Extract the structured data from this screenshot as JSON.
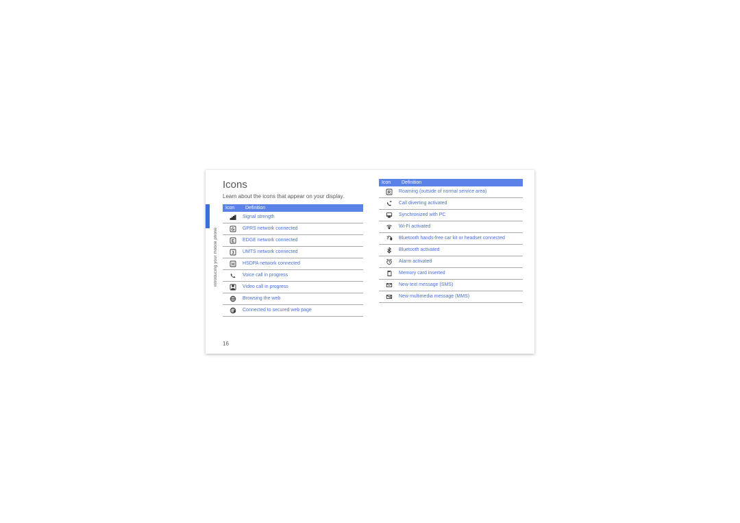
{
  "section": {
    "title": "Icons",
    "intro": "Learn about the icons that appear on your display.",
    "side_label": "introducing your mobile phone",
    "page_number": "16",
    "header": {
      "icon": "Icon",
      "definition": "Definition"
    }
  },
  "left_rows": [
    {
      "icon": "signal",
      "definition": "Signal strength"
    },
    {
      "icon": "gprs",
      "definition": "GPRS network connected"
    },
    {
      "icon": "edge",
      "definition": "EDGE network connected"
    },
    {
      "icon": "umts",
      "definition": "UMTS network connected"
    },
    {
      "icon": "hsdpa",
      "definition": "HSDPA network connected"
    },
    {
      "icon": "voice",
      "definition": "Voice call in progress"
    },
    {
      "icon": "video",
      "definition": "Video call in progress"
    },
    {
      "icon": "web",
      "definition": "Browsing the web"
    },
    {
      "icon": "secure",
      "definition": "Connected to secured web page"
    }
  ],
  "right_rows": [
    {
      "icon": "roaming",
      "definition": "Roaming (outside of normal service area)"
    },
    {
      "icon": "divert",
      "definition": "Call diverting activated"
    },
    {
      "icon": "sync",
      "definition": "Synchronized with PC"
    },
    {
      "icon": "wifi",
      "definition": "Wi-Fi activated"
    },
    {
      "icon": "bthead",
      "definition": "Bluetooth hands-free car kit or headset connected"
    },
    {
      "icon": "bt",
      "definition": "Bluetooth activated"
    },
    {
      "icon": "alarm",
      "definition": "Alarm activated"
    },
    {
      "icon": "memcard",
      "definition": "Memory card inserted"
    },
    {
      "icon": "sms",
      "definition": "New text message (SMS)"
    },
    {
      "icon": "mms",
      "definition": "New multimedia message (MMS)"
    }
  ]
}
